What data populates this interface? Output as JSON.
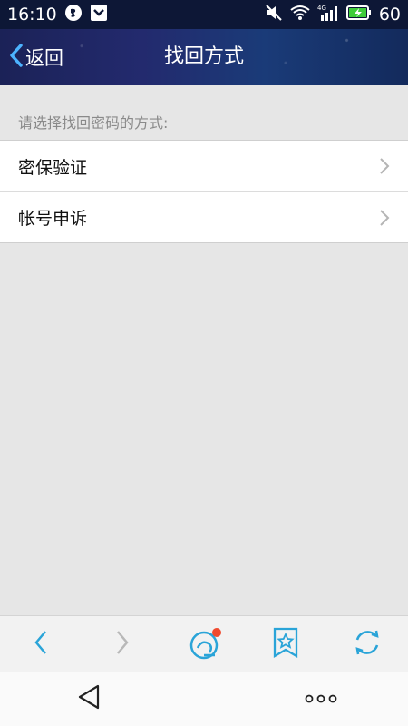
{
  "status_bar": {
    "time": "16:10",
    "battery_level": "60",
    "icons": [
      "browser-notification-icon",
      "download-icon",
      "mute-icon",
      "wifi-icon",
      "signal-4g-icon",
      "battery-charging-icon"
    ]
  },
  "nav": {
    "back_label": "返回",
    "title": "找回方式"
  },
  "content": {
    "prompt": "请选择找回密码的方式:",
    "options": [
      {
        "label": "密保验证"
      },
      {
        "label": "帐号申诉"
      }
    ]
  },
  "toolbar": {
    "buttons": [
      "back-arrow-icon",
      "forward-arrow-icon",
      "browser-home-icon",
      "bookmark-star-icon",
      "refresh-icon"
    ],
    "notification_dot_color": "#f04a2e",
    "accent_color": "#2aa4d8"
  },
  "system_nav": {
    "buttons": [
      "back-triangle-icon",
      "more-dots-icon"
    ]
  }
}
